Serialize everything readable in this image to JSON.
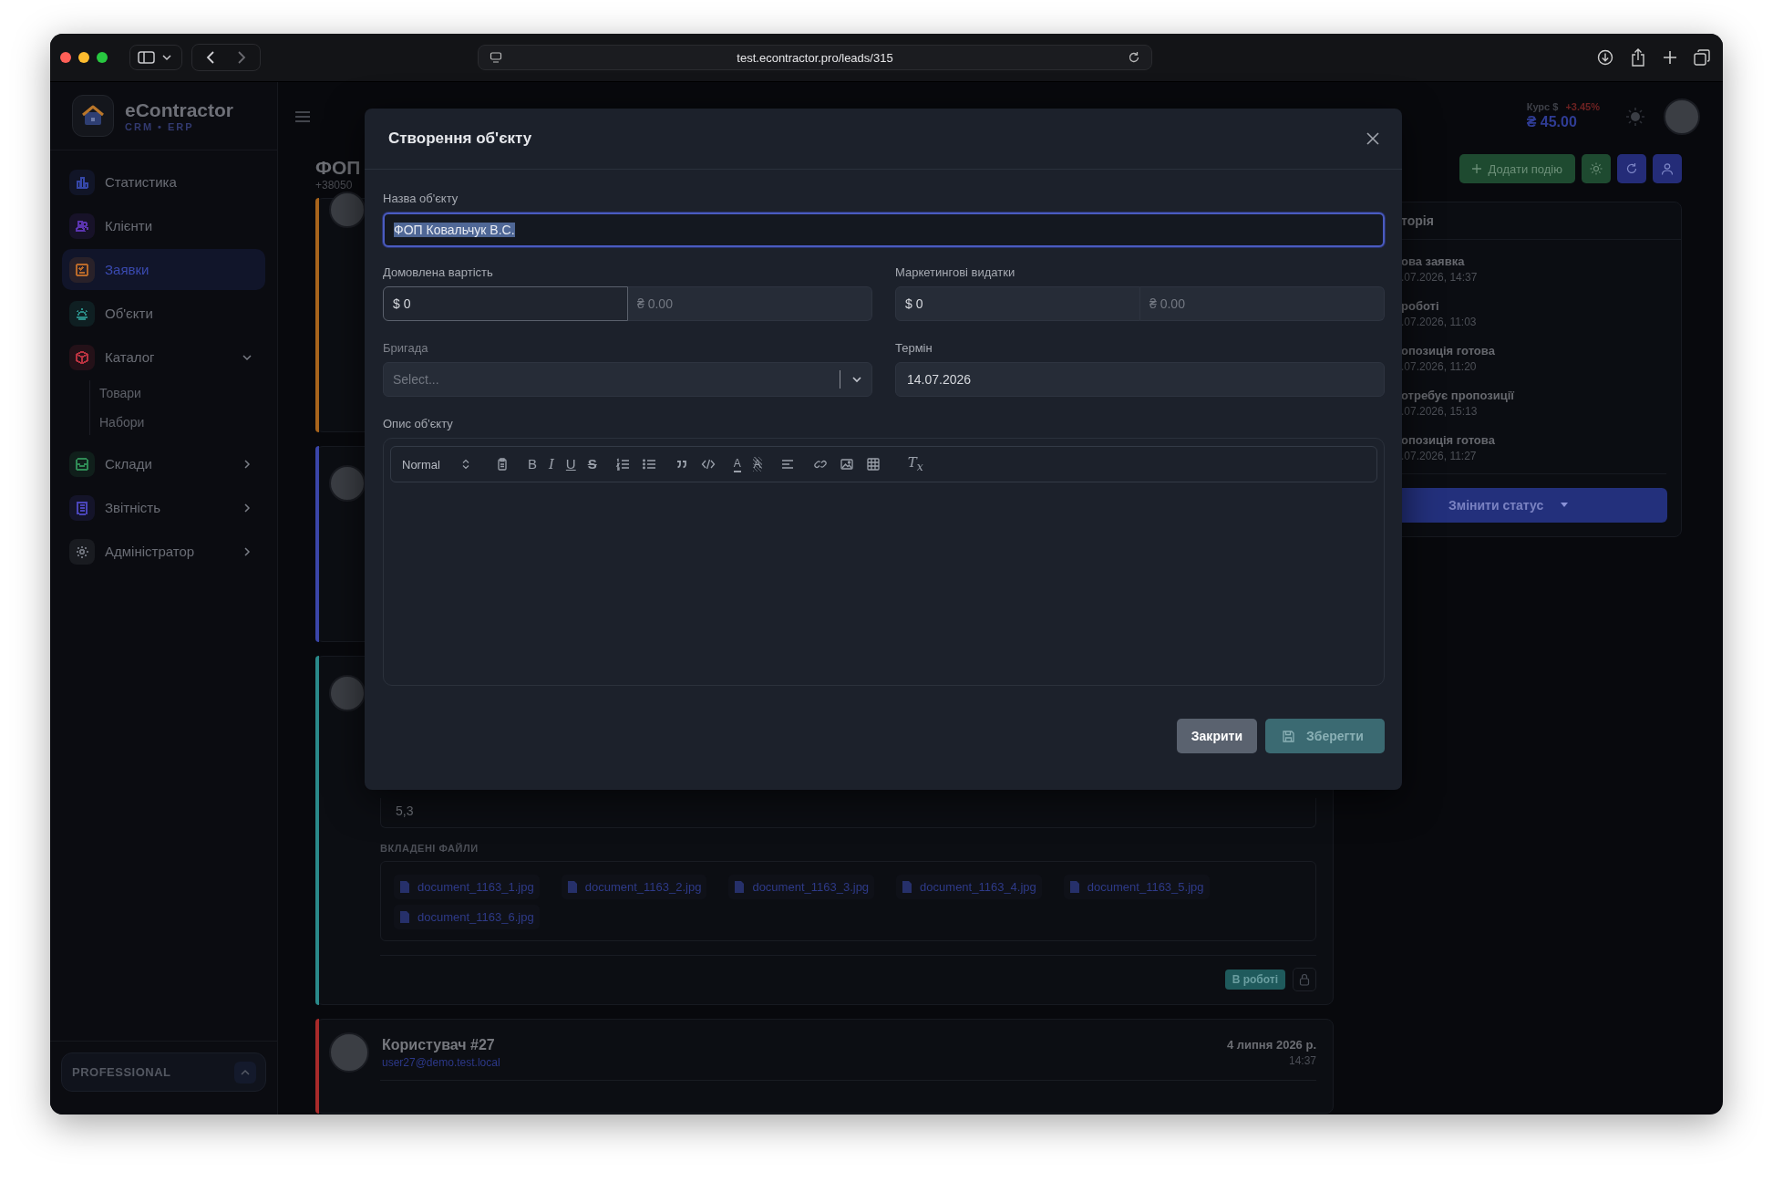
{
  "browser": {
    "url": "test.econtractor.pro/leads/315"
  },
  "sidebar": {
    "brand": "eContractor",
    "tagline": "CRM • ERP",
    "items": [
      {
        "label": "Статистика",
        "kind": "chart",
        "color": "#3547a8",
        "selected": false
      },
      {
        "label": "Клієнти",
        "kind": "users",
        "color": "#5b34b0",
        "selected": false
      },
      {
        "label": "Заявки",
        "kind": "request",
        "color": "#b8692a",
        "selected": true
      },
      {
        "label": "Об'єкти",
        "kind": "building",
        "color": "#2a8a85",
        "selected": false
      },
      {
        "label": "Каталог",
        "kind": "box",
        "color": "#b83240",
        "selected": false,
        "expanded": true,
        "children": [
          {
            "label": "Товари"
          },
          {
            "label": "Набори"
          }
        ]
      },
      {
        "label": "Склади",
        "kind": "warehouse",
        "color": "#2f8a55",
        "selected": false,
        "expanded": false
      },
      {
        "label": "Звітність",
        "kind": "report",
        "color": "#4a45b8",
        "selected": false,
        "expanded": false
      },
      {
        "label": "Адміністратор",
        "kind": "gear",
        "color": "#6b6f78",
        "selected": false,
        "expanded": false
      }
    ],
    "plan": "PROFESSIONAL"
  },
  "header": {
    "rate_label": "Курс $",
    "rate_change": "+3.45%",
    "rate_value": "₴ 45.00",
    "title": "ФОП",
    "phone": "+38050",
    "add_event_button": "Додати подію"
  },
  "cards": [
    {
      "color": "#a8641c"
    },
    {
      "color": "#3a45a8"
    },
    {
      "color": "#2a8a8a",
      "value": "5,3",
      "files_label": "ВКЛАДЕНІ ФАЙЛИ",
      "files": [
        "document_1163_1.jpg",
        "document_1163_2.jpg",
        "document_1163_3.jpg",
        "document_1163_4.jpg",
        "document_1163_5.jpg",
        "document_1163_6.jpg"
      ],
      "status_badge": "В роботі"
    },
    {
      "color": "#a82a2a",
      "author": "Користувач #27",
      "email": "user27@demo.test.local",
      "date": "4 липня 2026 р.",
      "time": "14:37"
    }
  ],
  "history": {
    "title": "торія",
    "entries": [
      {
        "status": "ова заявка",
        "time": ".07.2026, 14:37"
      },
      {
        "status": "роботі",
        "time": ".07.2026, 11:03"
      },
      {
        "status": "опозиція готова",
        "time": ".07.2026, 11:20"
      },
      {
        "status": "отребує пропозиції",
        "time": ".07.2026, 15:13"
      },
      {
        "status": "опозиція готова",
        "time": ".07.2026, 11:27"
      }
    ],
    "change_status_button": "Змінити статус"
  },
  "modal": {
    "title": "Створення об'єкту",
    "name_label": "Назва об'єкту",
    "name_value": "ФОП Ковальчук В.С.",
    "name_focused": true,
    "name_text_selected": true,
    "price_label": "Домовлена вартість",
    "price_usd": "$ 0",
    "price_uah_placeholder": "₴ 0.00",
    "marketing_label": "Маркетингові видатки",
    "marketing_usd": "$ 0",
    "marketing_uah_placeholder": "₴ 0.00",
    "team_label": "Бригада",
    "team_placeholder": "Select...",
    "deadline_label": "Термін",
    "deadline_value": "14.07.2026",
    "description_label": "Опис об'єкту",
    "toolbar": [
      [
        {
          "kind": "header",
          "label": "Normal"
        }
      ],
      [
        {
          "kind": "clipboard"
        }
      ],
      [
        {
          "kind": "bold",
          "glyph": "B"
        },
        {
          "kind": "italic",
          "glyph": "I"
        },
        {
          "kind": "underline",
          "glyph": "U"
        },
        {
          "kind": "strike",
          "glyph": "S"
        }
      ],
      [
        {
          "kind": "ordered-list"
        },
        {
          "kind": "bullet-list"
        }
      ],
      [
        {
          "kind": "blockquote"
        },
        {
          "kind": "code"
        }
      ],
      [
        {
          "kind": "color",
          "glyph": "A"
        },
        {
          "kind": "background",
          "glyph": "A"
        }
      ],
      [
        {
          "kind": "align"
        }
      ],
      [
        {
          "kind": "link"
        },
        {
          "kind": "image"
        },
        {
          "kind": "table"
        }
      ],
      [
        {
          "kind": "clean",
          "glyph": "T$_{x}$"
        }
      ]
    ],
    "close_button": "Закрити",
    "save_button": "Зберегти",
    "save_disabled": true
  }
}
